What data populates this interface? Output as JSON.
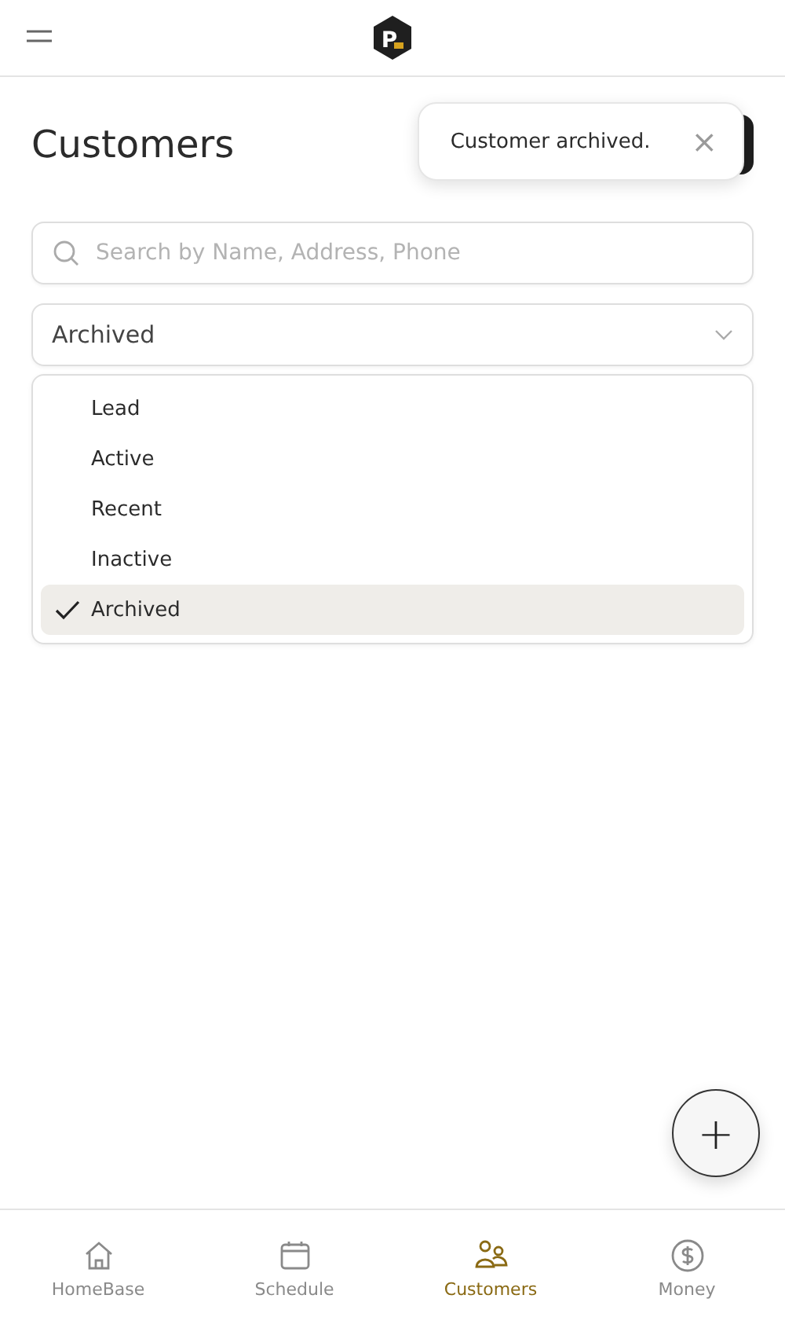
{
  "header": {
    "logo_letter": "P"
  },
  "page": {
    "title": "Customers"
  },
  "toast": {
    "message": "Customer archived.",
    "close": "×"
  },
  "search": {
    "placeholder": "Search by Name, Address, Phone"
  },
  "status_filter": {
    "value": "Archived",
    "expanded": true
  },
  "status_options": [
    {
      "label": "Lead",
      "selected": false
    },
    {
      "label": "Active",
      "selected": false
    },
    {
      "label": "Recent",
      "selected": false
    },
    {
      "label": "Inactive",
      "selected": false
    },
    {
      "label": "Archived",
      "selected": true
    }
  ],
  "fab": {
    "label": "+"
  },
  "nav": [
    {
      "kind": "home",
      "label": "HomeBase",
      "selected": false
    },
    {
      "kind": "calendar",
      "label": "Schedule",
      "selected": false
    },
    {
      "kind": "people",
      "label": "Customers",
      "selected": true
    },
    {
      "kind": "money",
      "label": "Money",
      "selected": false
    }
  ]
}
